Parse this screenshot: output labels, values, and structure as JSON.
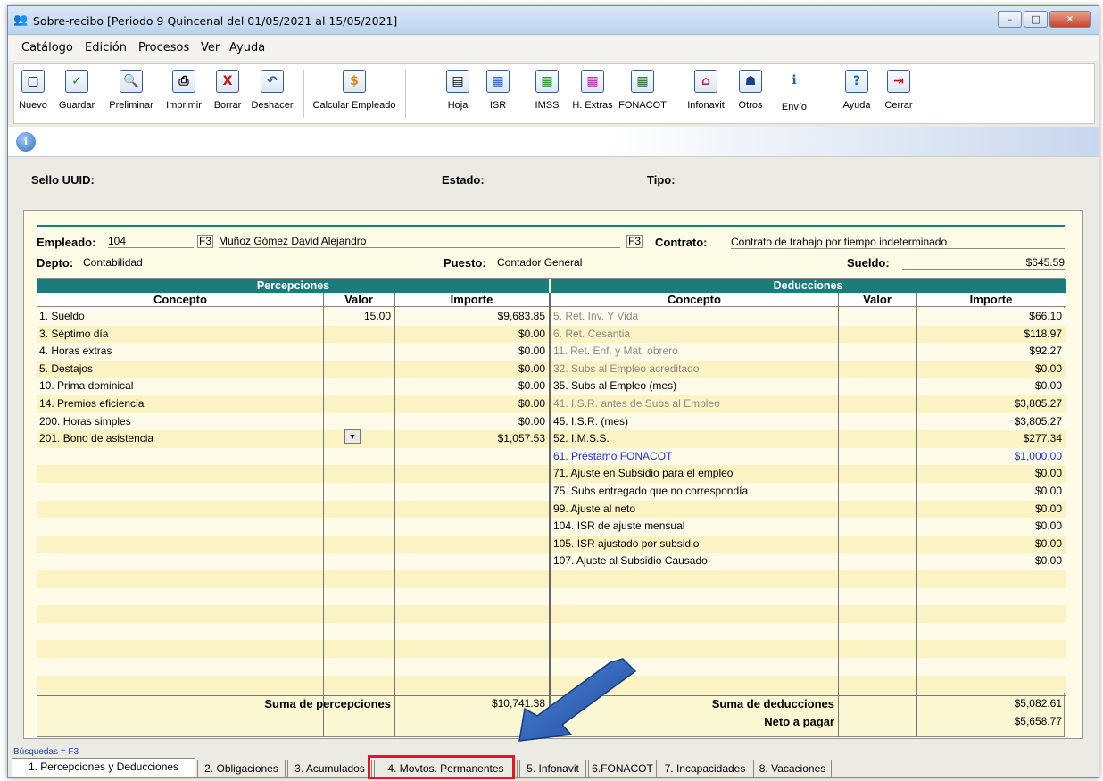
{
  "window": {
    "title": "Sobre-recibo  [Periodo 9 Quincenal del 01/05/2021 al 15/05/2021]",
    "controls": {
      "minimize": "–",
      "maximize": "□",
      "close": "✕"
    }
  },
  "menu": [
    "Catálogo",
    "Edición",
    "Procesos",
    "Ver",
    "Ayuda"
  ],
  "toolbar": [
    {
      "label": "Nuevo",
      "icon": "new-doc-icon"
    },
    {
      "label": "Guardar",
      "icon": "checkmark-icon"
    },
    {
      "label": "Preliminar",
      "icon": "preview-icon"
    },
    {
      "label": "Imprimir",
      "icon": "printer-icon"
    },
    {
      "label": "Borrar",
      "icon": "delete-x-icon"
    },
    {
      "label": "Deshacer",
      "icon": "undo-icon"
    },
    {
      "label": "Calcular Empleado",
      "icon": "calculate-icon"
    },
    {
      "label": "Hoja",
      "icon": "sheet-icon"
    },
    {
      "label": "ISR",
      "icon": "isr-icon"
    },
    {
      "label": "IMSS",
      "icon": "imss-icon"
    },
    {
      "label": "H. Extras",
      "icon": "overtime-icon"
    },
    {
      "label": "FONACOT",
      "icon": "fonacot-icon"
    },
    {
      "label": "Infonavit",
      "icon": "infonavit-icon"
    },
    {
      "label": "Otros",
      "icon": "others-icon"
    },
    {
      "label": "Envío",
      "icon": "send-icon"
    },
    {
      "label": "Ayuda",
      "icon": "help-icon"
    },
    {
      "label": "Cerrar",
      "icon": "close-door-icon"
    }
  ],
  "header": {
    "sello_label": "Sello UUID:",
    "estado_label": "Estado:",
    "tipo_label": "Tipo:"
  },
  "employee": {
    "empleado_label": "Empleado:",
    "empleado_num": "104",
    "f3": "F3",
    "empleado_nombre": "Muñoz Gómez David Alejandro",
    "contrato_label": "Contrato:",
    "contrato": "Contrato de trabajo por tiempo indeterminado",
    "depto_label": "Depto:",
    "depto": "Contabilidad",
    "puesto_label": "Puesto:",
    "puesto": "Contador General",
    "sueldo_label": "Sueldo:",
    "sueldo": "$645.59"
  },
  "percepciones": {
    "title": "Percepciones",
    "headers": [
      "Concepto",
      "Valor",
      "Importe"
    ],
    "rows": [
      {
        "concepto": "1. Sueldo",
        "valor": "15.00",
        "importe": "$9,683.85"
      },
      {
        "concepto": "3. Séptimo día",
        "valor": "",
        "importe": "$0.00"
      },
      {
        "concepto": "4. Horas extras",
        "valor": "",
        "importe": "$0.00"
      },
      {
        "concepto": "5. Destajos",
        "valor": "",
        "importe": "$0.00"
      },
      {
        "concepto": "10. Prima dominical",
        "valor": "",
        "importe": "$0.00"
      },
      {
        "concepto": "14. Premios eficiencia",
        "valor": "",
        "importe": "$0.00"
      },
      {
        "concepto": "200. Horas simples",
        "valor": "",
        "importe": "$0.00"
      },
      {
        "concepto": "201. Bono de asistencia",
        "valor": "",
        "importe": "$1,057.53"
      }
    ],
    "sum_label": "Suma de percepciones",
    "sum_value": "$10,741.38"
  },
  "deducciones": {
    "title": "Deducciones",
    "headers": [
      "Concepto",
      "Valor",
      "Importe"
    ],
    "rows": [
      {
        "concepto": "5. Ret. Inv. Y Vida",
        "importe": "$66.10",
        "style": "gray"
      },
      {
        "concepto": "6. Ret. Cesantia",
        "importe": "$118.97",
        "style": "gray"
      },
      {
        "concepto": "11. Ret. Enf. y Mat. obrero",
        "importe": "$92.27",
        "style": "gray"
      },
      {
        "concepto": "32. Subs al Empleo acreditado",
        "importe": "$0.00",
        "style": "gray"
      },
      {
        "concepto": "35. Subs al Empleo (mes)",
        "importe": "$0.00",
        "style": ""
      },
      {
        "concepto": "41. I.S.R. antes de Subs al Empleo",
        "importe": "$3,805.27",
        "style": "gray"
      },
      {
        "concepto": "45. I.S.R. (mes)",
        "importe": "$3,805.27",
        "style": ""
      },
      {
        "concepto": "52. I.M.S.S.",
        "importe": "$277.34",
        "style": ""
      },
      {
        "concepto": "61. Préstamo FONACOT",
        "importe": "$1,000.00",
        "style": "blue"
      },
      {
        "concepto": "71. Ajuste en Subsidio para el empleo",
        "importe": "$0.00",
        "style": ""
      },
      {
        "concepto": "75. Subs entregado que no correspondía",
        "importe": "$0.00",
        "style": ""
      },
      {
        "concepto": "99. Ajuste al neto",
        "importe": "$0.00",
        "style": ""
      },
      {
        "concepto": "104. ISR de ajuste mensual",
        "importe": "$0.00",
        "style": ""
      },
      {
        "concepto": "105. ISR ajustado por subsidio",
        "importe": "$0.00",
        "style": ""
      },
      {
        "concepto": "107. Ajuste al Subsidio Causado",
        "importe": "$0.00",
        "style": ""
      }
    ],
    "sum_label": "Suma de deducciones",
    "sum_value": "$5,082.61",
    "neto_label": "Neto a pagar",
    "neto_value": "$5,658.77"
  },
  "busquedas": "Búsquedas = F3",
  "tabs": [
    "1. Percepciones y Deducciones",
    "2. Obligaciones",
    "3. Acumulados",
    "4. Movtos. Permanentes",
    "5. Infonavit",
    "6.FONACOT",
    "7. Incapacidades",
    "8. Vacaciones"
  ],
  "annotation": {
    "highlight_color": "#e8141e",
    "arrow_color": "#2c5fb8"
  }
}
